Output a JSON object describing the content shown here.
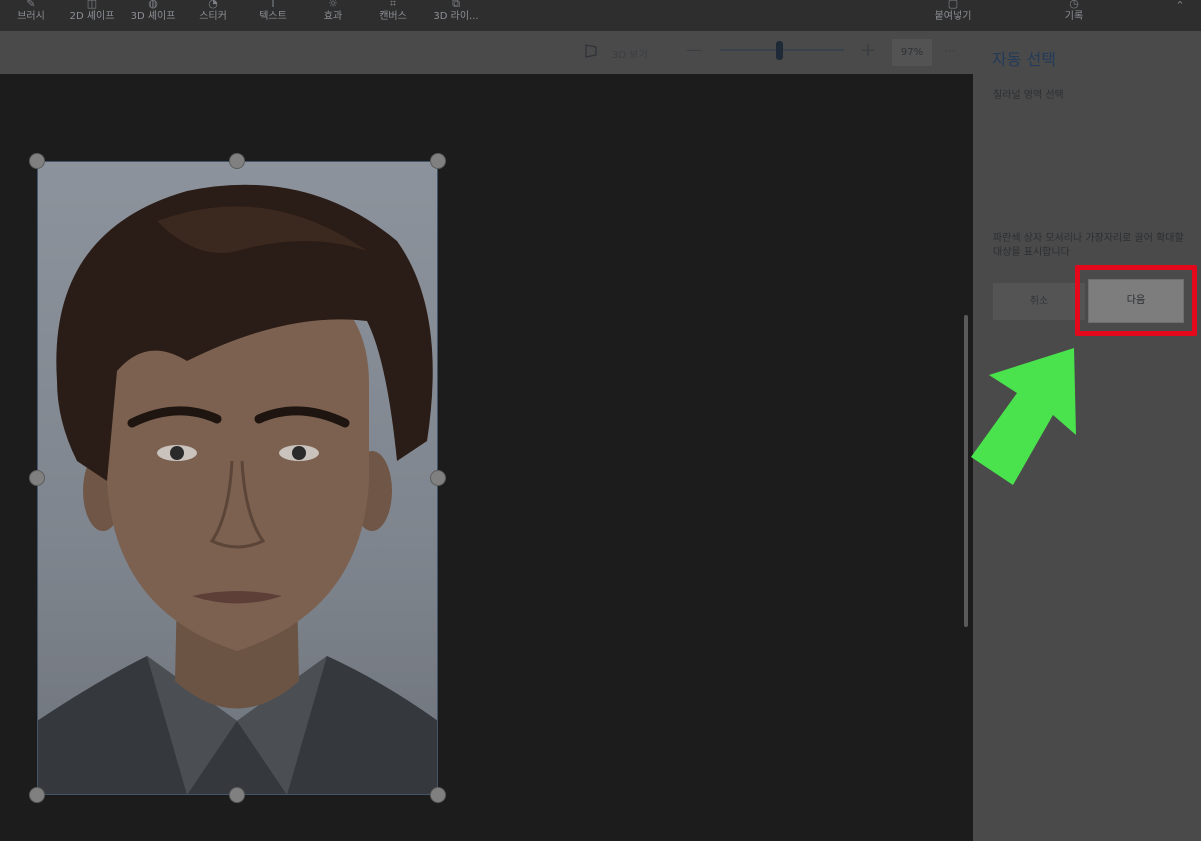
{
  "toolbar": {
    "items": [
      {
        "label": "브러시",
        "icon": "brush-icon"
      },
      {
        "label": "2D 셰이프",
        "icon": "shapes-2d-icon"
      },
      {
        "label": "3D 셰이프",
        "icon": "shapes-3d-icon"
      },
      {
        "label": "스티커",
        "icon": "sticker-icon"
      },
      {
        "label": "텍스트",
        "icon": "text-icon"
      },
      {
        "label": "효과",
        "icon": "effects-icon"
      },
      {
        "label": "캔버스",
        "icon": "canvas-icon"
      },
      {
        "label": "3D 라이...",
        "icon": "library-3d-icon"
      }
    ],
    "paste_label": "붙여넣기",
    "history_label": "기록"
  },
  "viewbar": {
    "view_3d_label": "3D 보기",
    "zoom_minus": "—",
    "zoom_plus": "+",
    "zoom_value": "97%",
    "more": "···",
    "zoom_level_percent": 97
  },
  "panel": {
    "title": "자동 선택",
    "subtitle": "칠라널 영역 선택",
    "description": "파란색 상자 모서리나 가장자리로 끌어 확대할 대상을 표시합니다",
    "cancel_label": "취소",
    "next_label": "다음"
  },
  "colors": {
    "highlight": "#e3081b",
    "arrow": "#4ae34d",
    "accent": "#233a58"
  }
}
